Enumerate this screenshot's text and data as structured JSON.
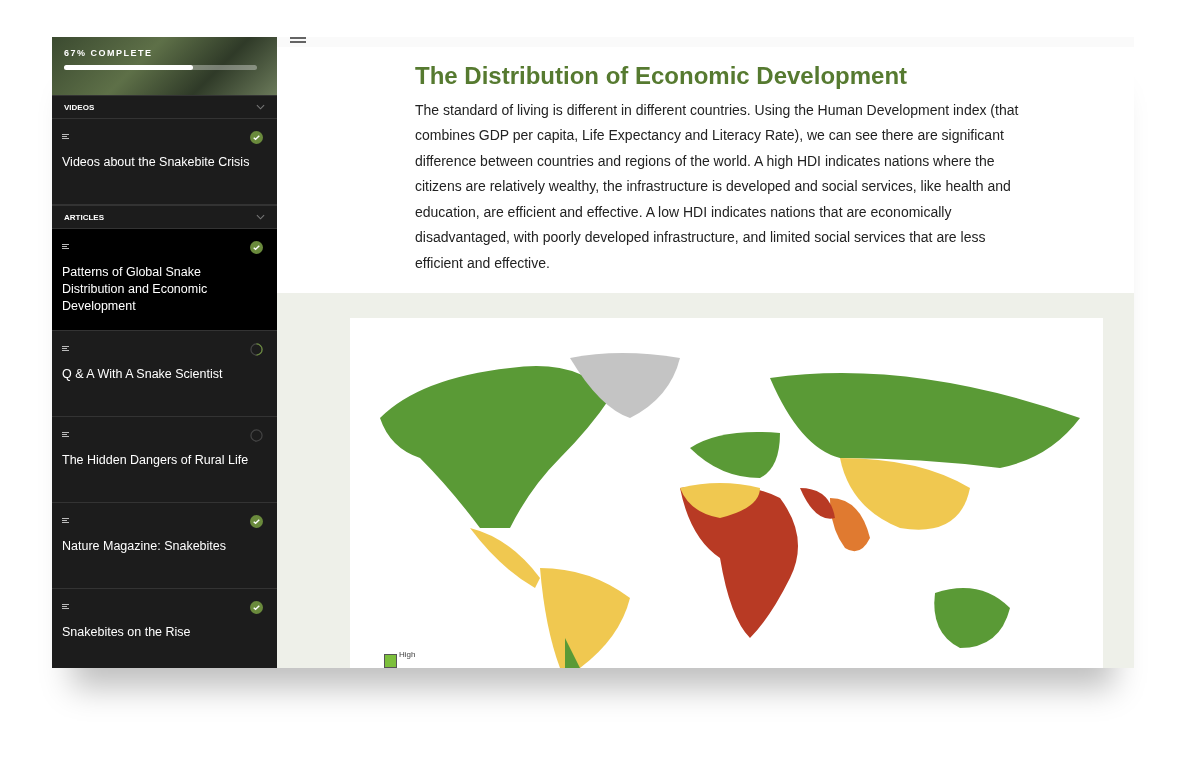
{
  "progress": {
    "label": "67% COMPLETE",
    "level": 0.67
  },
  "sections": [
    {
      "title": "VIDEOS",
      "expanded": true,
      "items": [
        {
          "title": "Videos about the Snakebite Crisis",
          "kind": "done",
          "selected": false
        }
      ]
    },
    {
      "title": "ARTICLES",
      "expanded": true,
      "items": [
        {
          "title": "Patterns of Global Snake Distribution and Economic Development",
          "kind": "done",
          "selected": true
        },
        {
          "title": "Q & A With A Snake Scientist",
          "kind": "started",
          "selected": false
        },
        {
          "title": "The Hidden Dangers of Rural Life",
          "kind": "new",
          "selected": false
        },
        {
          "title": "Nature Magazine: Snakebites",
          "kind": "done",
          "selected": false
        },
        {
          "title": "Snakebites on the Rise",
          "kind": "done",
          "selected": false
        }
      ]
    }
  ],
  "article": {
    "title": "The Distribution of Economic Development",
    "body": "The standard of living is different in different countries. Using the Human Development index (that combines GDP per capita, Life Expectancy and Literacy Rate), we can see there are significant difference between countries and regions of the world. A high HDI indicates nations where the citizens are relatively wealthy, the infrastructure is developed and social services, like health and education, are efficient and effective. A low HDI indicates nations that are economically disadvantaged, with poorly developed infrastructure, and limited social services that are less efficient and effective."
  },
  "map": {
    "legend": [
      {
        "label": "High",
        "color": "#7cbf3c"
      }
    ]
  }
}
